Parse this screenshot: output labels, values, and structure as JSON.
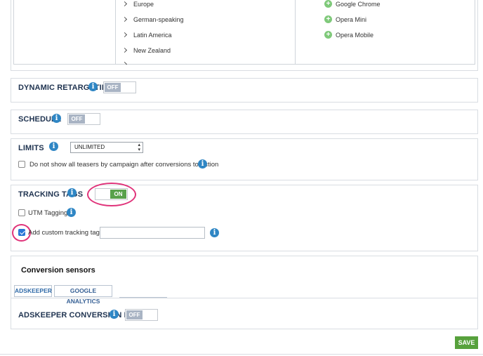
{
  "regions": [
    {
      "label": "Europe"
    },
    {
      "label": "German-speaking"
    },
    {
      "label": "Latin America"
    },
    {
      "label": "New Zealand"
    }
  ],
  "browsers": [
    {
      "label": "Google Chrome"
    },
    {
      "label": "Opera Mini"
    },
    {
      "label": "Opera Mobile"
    }
  ],
  "dynamic_retargeting": {
    "label": "DYNAMIC RETARGETING",
    "toggle": "OFF"
  },
  "schedule": {
    "label": "SCHEDULE",
    "toggle": "OFF"
  },
  "limits": {
    "label": "LIMITS",
    "select_value": "UNLIMITED",
    "checkbox_label": "Do not show all teasers by campaign after conversions to Action"
  },
  "tracking_tags": {
    "label": "TRACKING TAGS",
    "toggle": "ON",
    "utm_label": "UTM Tagging",
    "custom_label": "Add custom tracking tag",
    "custom_value": ""
  },
  "conversion_sensors": {
    "title": "Conversion sensors",
    "tabs": [
      {
        "label": "ADSKEEPER"
      },
      {
        "label": "GOOGLE ANALYTICS"
      }
    ],
    "pixel_label": "ADSKEEPER CONVERSION PIXEL",
    "pixel_toggle": "OFF"
  },
  "save_label": "SAVE",
  "colors": {
    "accent": "#2f86c4",
    "on": "#58a14b",
    "highlight": "#e0337a"
  }
}
